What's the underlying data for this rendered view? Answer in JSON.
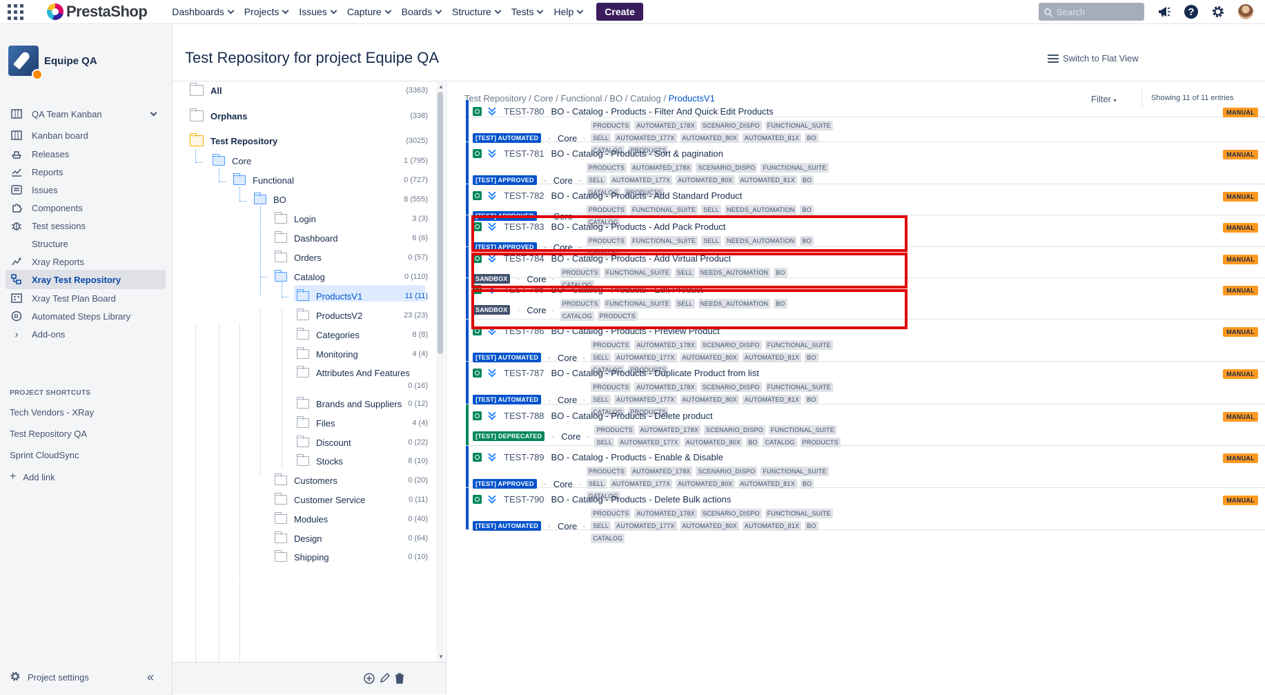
{
  "topnav": {
    "logo": "PrestaShop",
    "menu": [
      "Dashboards",
      "Projects",
      "Issues",
      "Capture",
      "Boards",
      "Structure",
      "Tests",
      "Help"
    ],
    "create": "Create",
    "search_placeholder": "Search"
  },
  "sidebar": {
    "project": "Equipe QA",
    "items": [
      {
        "label": "QA Team Kanban",
        "icon": "board-icon"
      },
      {
        "label": "Kanban board",
        "icon": "kanban-icon"
      },
      {
        "label": "Releases",
        "icon": "ship-icon"
      },
      {
        "label": "Reports",
        "icon": "chart-icon"
      },
      {
        "label": "Issues",
        "icon": "issues-icon"
      },
      {
        "label": "Components",
        "icon": "puzzle-icon"
      },
      {
        "label": "Test sessions",
        "icon": "bug-icon"
      },
      {
        "label": "Structure",
        "icon": ""
      },
      {
        "label": "Xray Reports",
        "icon": "xray-report-icon"
      },
      {
        "label": "Xray Test Repository",
        "icon": "xray-repo-icon"
      },
      {
        "label": "Xray Test Plan Board",
        "icon": "xray-plan-icon"
      },
      {
        "label": "Automated Steps Library",
        "icon": "library-icon"
      },
      {
        "label": "Add-ons",
        "icon": "chevron-right-icon"
      }
    ],
    "shortcuts_title": "PROJECT SHORTCUTS",
    "shortcuts": [
      "Tech Vendors - XRay",
      "Test Repository QA",
      "Sprint CloudSync"
    ],
    "add_link": "Add link",
    "settings": "Project settings"
  },
  "header": {
    "title": "Test Repository for project Equipe QA",
    "flat_view": "Switch to Flat View"
  },
  "tree": [
    {
      "label": "All",
      "count": "(3363)"
    },
    {
      "label": "Orphans",
      "count": "(338)"
    },
    {
      "label": "Test Repository",
      "count": "(3025)"
    },
    {
      "label": "Core",
      "count": "1 (795)"
    },
    {
      "label": "Functional",
      "count": "0 (727)"
    },
    {
      "label": "BO",
      "count": "8 (555)"
    },
    {
      "label": "Login",
      "count": "3 (3)"
    },
    {
      "label": "Dashboard",
      "count": "6 (6)"
    },
    {
      "label": "Orders",
      "count": "0 (57)"
    },
    {
      "label": "Catalog",
      "count": "0 (110)"
    },
    {
      "label": "ProductsV1",
      "count": "11 (11)"
    },
    {
      "label": "ProductsV2",
      "count": "23 (23)"
    },
    {
      "label": "Categories",
      "count": "8 (8)"
    },
    {
      "label": "Monitoring",
      "count": "4 (4)"
    },
    {
      "label": "Attributes And Features",
      "count": "0 (16)"
    },
    {
      "label": "Brands and Suppliers",
      "count": "0 (12)"
    },
    {
      "label": "Files",
      "count": "4 (4)"
    },
    {
      "label": "Discount",
      "count": "0 (22)"
    },
    {
      "label": "Stocks",
      "count": "8 (10)"
    },
    {
      "label": "Customers",
      "count": "0 (20)"
    },
    {
      "label": "Customer Service",
      "count": "0 (11)"
    },
    {
      "label": "Modules",
      "count": "0 (40)"
    },
    {
      "label": "Design",
      "count": "0 (64)"
    },
    {
      "label": "Shipping",
      "count": "0 (10)"
    }
  ],
  "list": {
    "breadcrumb": [
      "Test Repository",
      "Core",
      "Functional",
      "BO",
      "Catalog"
    ],
    "breadcrumb_current": "ProductsV1",
    "filter": "Filter",
    "showing": "Showing 11 of 11 entries",
    "manual": "MANUAL",
    "entries": [
      {
        "key": "TEST-780",
        "summary": "BO - Catalog - Products - Filter And Quick Edit Products",
        "status": "[TEST] AUTOMATED",
        "component": "Core",
        "labels": [
          "PRODUCTS",
          "AUTOMATED_178X",
          "SCENARIO_DISPO",
          "FUNCTIONAL_SUITE",
          "SELL",
          "AUTOMATED_177X",
          "AUTOMATED_80X",
          "AUTOMATED_81X",
          "BO",
          "CATALOG",
          "PRODUCTS"
        ]
      },
      {
        "key": "TEST-781",
        "summary": "BO - Catalog - Products - Sort & pagination",
        "status": "[TEST] APPROVED",
        "component": "Core",
        "labels": [
          "PRODUCTS",
          "AUTOMATED_178X",
          "SCENARIO_DISPO",
          "FUNCTIONAL_SUITE",
          "SELL",
          "AUTOMATED_177X",
          "AUTOMATED_80X",
          "AUTOMATED_81X",
          "BO",
          "CATALOG",
          "PRODUCTS"
        ]
      },
      {
        "key": "TEST-782",
        "summary": "BO - Catalog - Products - Add Standard Product",
        "status": "[TEST] APPROVED",
        "component": "Core",
        "labels": [
          "PRODUCTS",
          "FUNCTIONAL_SUITE",
          "SELL",
          "NEEDS_AUTOMATION",
          "BO",
          "CATALOG"
        ]
      },
      {
        "key": "TEST-783",
        "summary": "BO - Catalog - Products - Add Pack Product",
        "status": "[TEST] APPROVED",
        "component": "Core",
        "labels": [
          "PRODUCTS",
          "FUNCTIONAL_SUITE",
          "SELL",
          "NEEDS_AUTOMATION",
          "BO",
          "CATALOG"
        ]
      },
      {
        "key": "TEST-784",
        "summary": "BO - Catalog - Products - Add Virtual Product",
        "status": "SANDBOX",
        "component": "Core",
        "labels": [
          "PRODUCTS",
          "FUNCTIONAL_SUITE",
          "SELL",
          "NEEDS_AUTOMATION",
          "BO",
          "CATALOG"
        ]
      },
      {
        "key": "TEST-785",
        "summary": "BO - Catalog - Products - Edit Product",
        "status": "SANDBOX",
        "component": "Core",
        "labels": [
          "PRODUCTS",
          "FUNCTIONAL_SUITE",
          "SELL",
          "NEEDS_AUTOMATION",
          "BO",
          "CATALOG",
          "PRODUCTS"
        ]
      },
      {
        "key": "TEST-786",
        "summary": "BO - Catalog - Products - Preview Product",
        "status": "[TEST] AUTOMATED",
        "component": "Core",
        "labels": [
          "PRODUCTS",
          "AUTOMATED_178X",
          "SCENARIO_DISPO",
          "FUNCTIONAL_SUITE",
          "SELL",
          "AUTOMATED_177X",
          "AUTOMATED_80X",
          "AUTOMATED_81X",
          "BO",
          "CATALOG",
          "PRODUCTS"
        ]
      },
      {
        "key": "TEST-787",
        "summary": "BO - Catalog - Products - Duplicate Product from list",
        "status": "[TEST] AUTOMATED",
        "component": "Core",
        "labels": [
          "PRODUCTS",
          "AUTOMATED_178X",
          "SCENARIO_DISPO",
          "FUNCTIONAL_SUITE",
          "SELL",
          "AUTOMATED_177X",
          "AUTOMATED_80X",
          "AUTOMATED_81X",
          "BO",
          "CATALOG",
          "PRODUCTS"
        ]
      },
      {
        "key": "TEST-788",
        "summary": "BO - Catalog - Products - Delete product",
        "status": "[TEST] DEPRECATED",
        "component": "Core",
        "labels": [
          "PRODUCTS",
          "AUTOMATED_178X",
          "SCENARIO_DISPO",
          "FUNCTIONAL_SUITE",
          "SELL",
          "AUTOMATED_177X",
          "AUTOMATED_80X",
          "BO",
          "CATALOG",
          "PRODUCTS"
        ]
      },
      {
        "key": "TEST-789",
        "summary": "BO - Catalog - Products - Enable & Disable",
        "status": "[TEST] APPROVED",
        "component": "Core",
        "labels": [
          "PRODUCTS",
          "AUTOMATED_178X",
          "SCENARIO_DISPO",
          "FUNCTIONAL_SUITE",
          "SELL",
          "AUTOMATED_177X",
          "AUTOMATED_80X",
          "AUTOMATED_81X",
          "BO",
          "CATALOG"
        ]
      },
      {
        "key": "TEST-790",
        "summary": "BO - Catalog - Products - Delete Bulk actions",
        "status": "[TEST] AUTOMATED",
        "component": "Core",
        "labels": [
          "PRODUCTS",
          "AUTOMATED_178X",
          "SCENARIO_DISPO",
          "FUNCTIONAL_SUITE",
          "SELL",
          "AUTOMATED_177X",
          "AUTOMATED_80X",
          "AUTOMATED_81X",
          "BO",
          "CATALOG"
        ]
      }
    ]
  }
}
